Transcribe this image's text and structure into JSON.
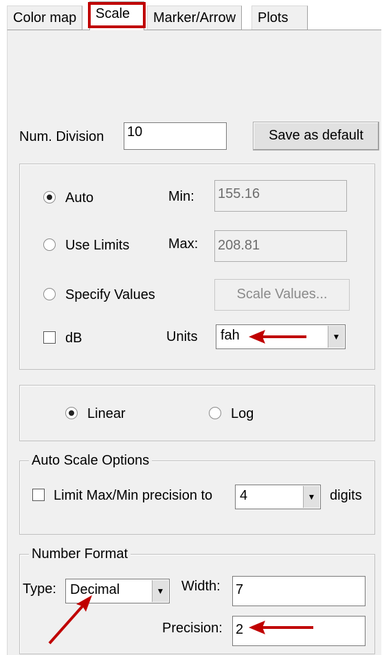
{
  "tabs": [
    {
      "label": "Color map",
      "active": false
    },
    {
      "label": "Scale",
      "active": true
    },
    {
      "label": "Marker/Arrow",
      "active": false
    },
    {
      "label": "Plots",
      "active": false
    }
  ],
  "scale": {
    "num_division_label": "Num. Division",
    "num_division_value": "10",
    "save_default_label": "Save as default",
    "range_mode": {
      "options": [
        "Auto",
        "Use Limits",
        "Specify Values"
      ],
      "selected": "Auto"
    },
    "min_label": "Min:",
    "min_value": "155.16",
    "max_label": "Max:",
    "max_value": "208.81",
    "scale_values_label": "Scale Values...",
    "db_label": "dB",
    "db_checked": false,
    "units_label": "Units",
    "units_value": "fah",
    "scale_type": {
      "options": [
        "Linear",
        "Log"
      ],
      "selected": "Linear"
    },
    "auto_scale": {
      "title": "Auto Scale Options",
      "limit_label": "Limit Max/Min precision to",
      "limit_checked": false,
      "digits_value": "4",
      "digits_label": "digits"
    },
    "number_format": {
      "title": "Number Format",
      "type_label": "Type:",
      "type_value": "Decimal",
      "width_label": "Width:",
      "width_value": "7",
      "precision_label": "Precision:",
      "precision_value": "2"
    }
  },
  "annotations": {
    "highlight_color": "#c00000",
    "arrow_color": "#c00000"
  }
}
